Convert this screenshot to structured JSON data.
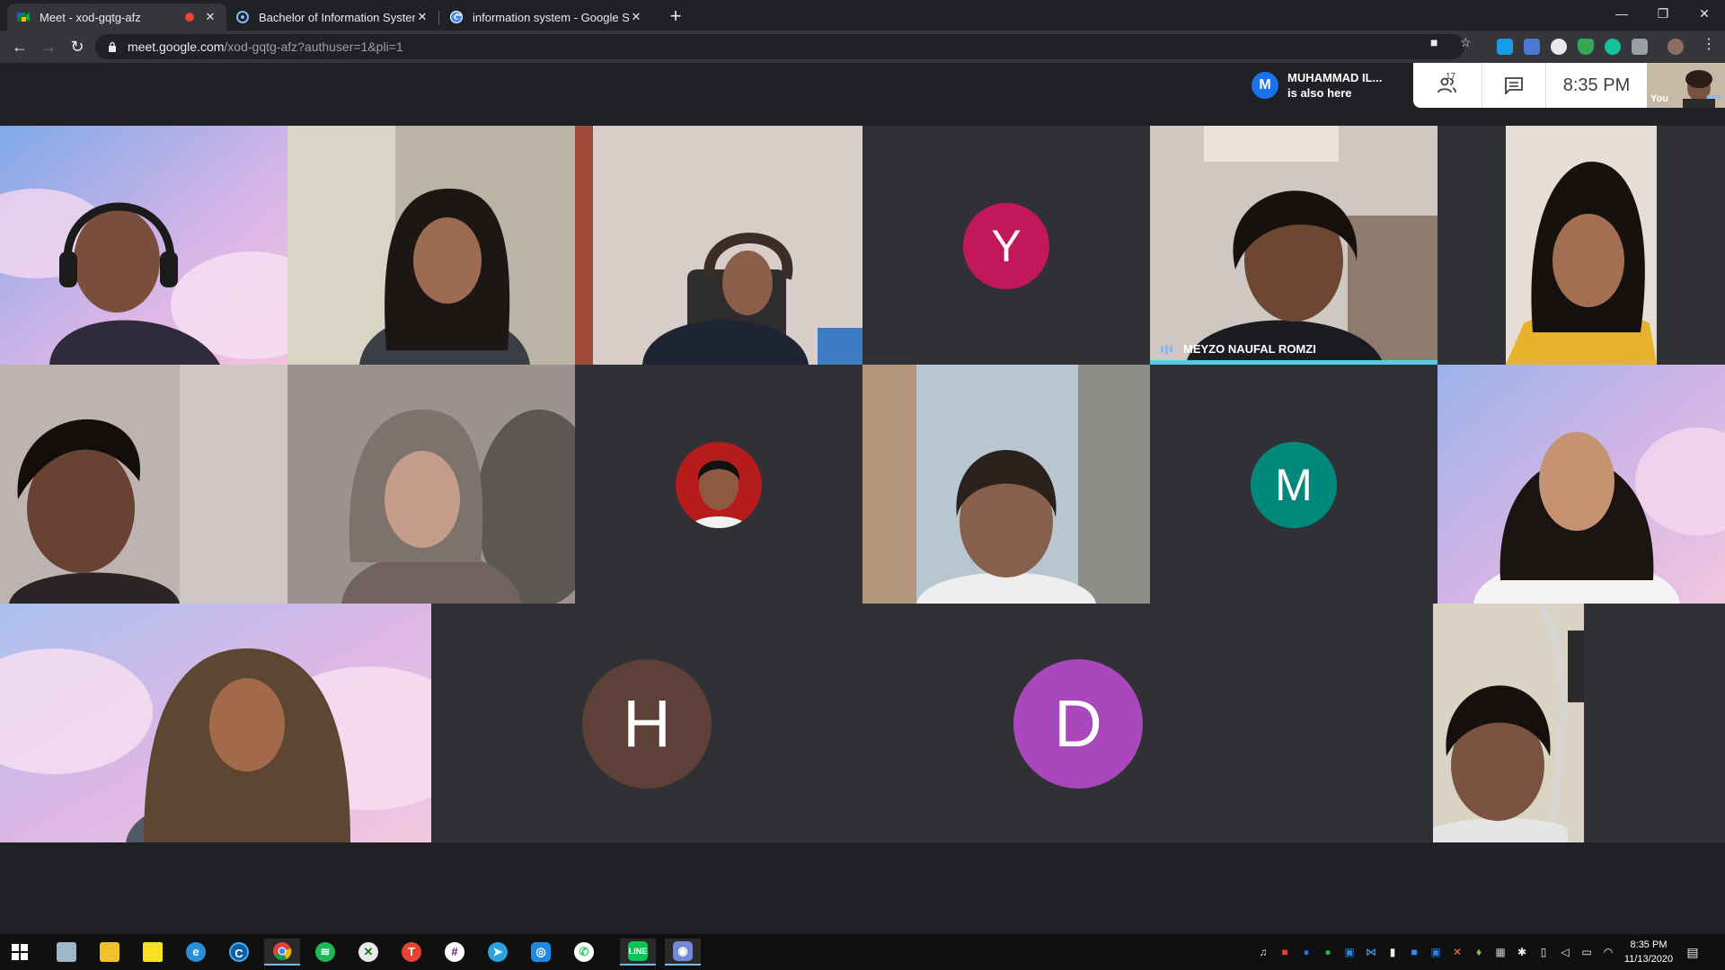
{
  "browser": {
    "tabs": [
      {
        "title": "Meet - xod-gqtg-afz",
        "recording": true,
        "active": true
      },
      {
        "title": "Bachelor of Information System |",
        "active": false
      },
      {
        "title": "information system - Google Sea",
        "active": false
      }
    ],
    "new_tab": "+",
    "url_host": "meet.google.com",
    "url_path": "/xod-gqtg-afz?authuser=1&pli=1",
    "window_controls": {
      "minimize": "—",
      "restore": "❐",
      "close": "✕"
    }
  },
  "meet": {
    "also_here": {
      "initial": "M",
      "name": "MUHAMMAD IL...",
      "subtitle": "is also here"
    },
    "participant_count": "17",
    "time": "8:35 PM",
    "self_label": "You",
    "self_more": "•••",
    "tiles": [
      {
        "kind": "video",
        "label": ""
      },
      {
        "kind": "video",
        "label": ""
      },
      {
        "kind": "video",
        "label": ""
      },
      {
        "kind": "letter",
        "letter": "Y",
        "color": "#c2185b"
      },
      {
        "kind": "video",
        "label": "MEYZO NAUFAL ROMZI",
        "speaking": true
      },
      {
        "kind": "video",
        "label": ""
      },
      {
        "kind": "video",
        "label": ""
      },
      {
        "kind": "video",
        "label": ""
      },
      {
        "kind": "photo",
        "label": ""
      },
      {
        "kind": "video",
        "label": ""
      },
      {
        "kind": "letter",
        "letter": "M",
        "color": "#00897b"
      },
      {
        "kind": "video",
        "label": ""
      },
      {
        "kind": "video",
        "label": ""
      },
      {
        "kind": "letter",
        "letter": "H",
        "color": "#5d4037"
      },
      {
        "kind": "letter",
        "letter": "D",
        "color": "#ab47bc"
      },
      {
        "kind": "video",
        "label": ""
      }
    ]
  },
  "taskbar": {
    "clock_time": "8:35 PM",
    "clock_date": "11/13/2020",
    "apps": [
      "windows-start",
      "file-explorer-pc",
      "file-explorer",
      "sticky-notes",
      "edge",
      "cortana-c",
      "chrome",
      "spotify",
      "xbox",
      "todoist-t",
      "slack",
      "telegram",
      "instagram",
      "whatsapp",
      "line",
      "discord"
    ]
  }
}
